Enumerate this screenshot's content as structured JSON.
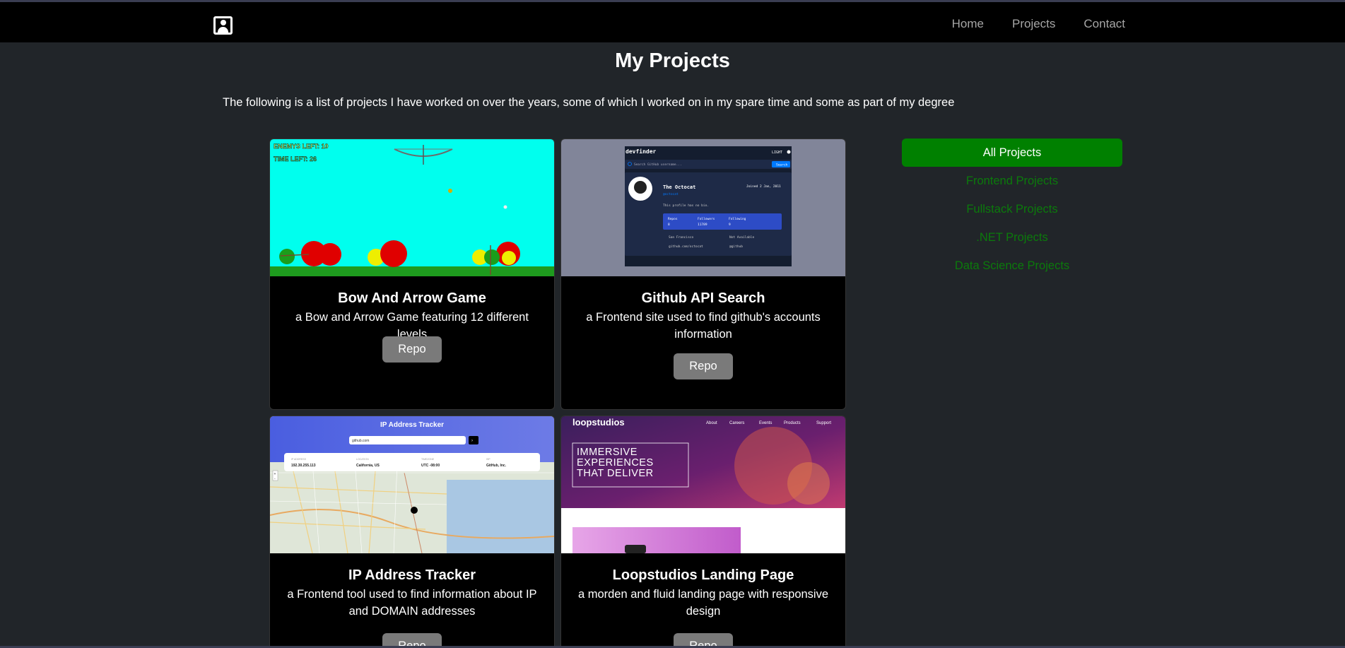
{
  "nav": {
    "links": [
      "Home",
      "Projects",
      "Contact"
    ]
  },
  "page": {
    "title": "My Projects",
    "intro": "The following is a list of projects I have worked on over the years, some of which I worked on in my spare time and some as part of my degree"
  },
  "projects": [
    {
      "title": "Bow And Arrow Game",
      "description": "a Bow and Arrow Game featuring 12 different levels",
      "button": "Repo",
      "thumb": {
        "enemies_text": "ENEMYS LEFT: 10",
        "time_text": "TIME LEFT: 26"
      }
    },
    {
      "title": "Github API Search",
      "description": "a Frontend site used to find github's accounts information",
      "button": "Repo",
      "thumb": {
        "app_name": "devfinder",
        "theme": "LIGHT",
        "search_placeholder": "Search GitHub username...",
        "search_button": "Search",
        "user_name": "The Octocat",
        "user_handle": "@octocat",
        "joined": "Joined 2 Jan, 2011",
        "bio": "This profile has no bio.",
        "stats": [
          {
            "label": "Repos",
            "value": "8"
          },
          {
            "label": "Followers",
            "value": "11789"
          },
          {
            "label": "Following",
            "value": "9"
          }
        ],
        "location": "San Francisco",
        "twitter": "Not Available",
        "blog": "github.com/octocat",
        "company": "@github"
      }
    },
    {
      "title": "IP Address Tracker",
      "description": "a Frontend tool used to find information about IP and DOMAIN addresses",
      "button": "Repo",
      "thumb": {
        "heading": "IP Address Tracker",
        "input_value": "github.com",
        "fields": [
          {
            "label": "IP ADDRESS",
            "value": "192.30.255.113"
          },
          {
            "label": "LOCATION",
            "value": "California, US"
          },
          {
            "label": "TIMEZONE",
            "value": "UTC -08:00"
          },
          {
            "label": "ISP",
            "value": "GitHub, Inc."
          }
        ]
      }
    },
    {
      "title": "Loopstudios Landing Page",
      "description": "a morden and fluid landing page with responsive design",
      "button": "Repo",
      "thumb": {
        "logo": "loopstudios",
        "menu": [
          "About",
          "Careers",
          "Events",
          "Products",
          "Support"
        ],
        "hero_text": "IMMERSIVE EXPERIENCES THAT DELIVER"
      }
    }
  ],
  "filters": [
    {
      "label": "All Projects",
      "active": true
    },
    {
      "label": "Frontend Projects",
      "active": false
    },
    {
      "label": "Fullstack Projects",
      "active": false
    },
    {
      "label": ".NET Projects",
      "active": false
    },
    {
      "label": "Data Science Projects",
      "active": false
    }
  ],
  "colors": {
    "background": "#212529",
    "navbar": "#000000",
    "accent_green": "#008000",
    "filter_text": "#0b7a0b",
    "repo_button": "#7a7a7a"
  }
}
